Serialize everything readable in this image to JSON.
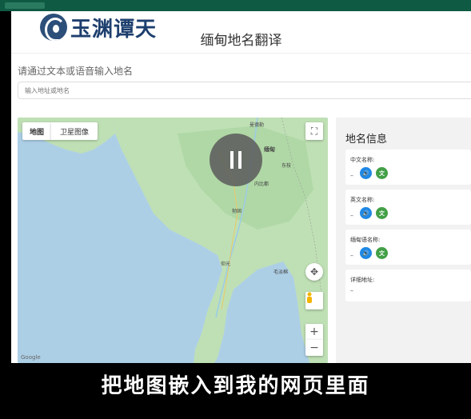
{
  "header": {
    "logo_text": "玉渊谭天",
    "title": "缅甸地名翻译"
  },
  "search": {
    "label": "请通过文本或语音输入地名",
    "placeholder": "输入地址或地名"
  },
  "map": {
    "type_map_label": "地图",
    "type_satellite_label": "卫星图像",
    "zoom_in": "+",
    "zoom_out": "−",
    "attribution": "Google",
    "cities": [
      "曼德勒",
      "缅甸",
      "东枝",
      "内比都",
      "勃固",
      "仰光",
      "毛淡棉"
    ],
    "colors": {
      "sea": "#adcfe6",
      "land": "#bfe0b5",
      "land_dark": "#9fcf98"
    }
  },
  "player": {
    "pause_icon": "pause-icon"
  },
  "info": {
    "title": "地名信息",
    "cards": [
      {
        "label": "中文名称:",
        "value": "–"
      },
      {
        "label": "英文名称:",
        "value": "–"
      },
      {
        "label": "缅甸语名称:",
        "value": "–"
      },
      {
        "label": "详细地址:",
        "value": "–"
      }
    ],
    "speak_icon": "speaker-icon",
    "translate_icon": "translate-icon",
    "colors": {
      "speak": "#1e88e5",
      "translate": "#43a047"
    }
  },
  "caption": "把地图嵌入到我的网页里面"
}
